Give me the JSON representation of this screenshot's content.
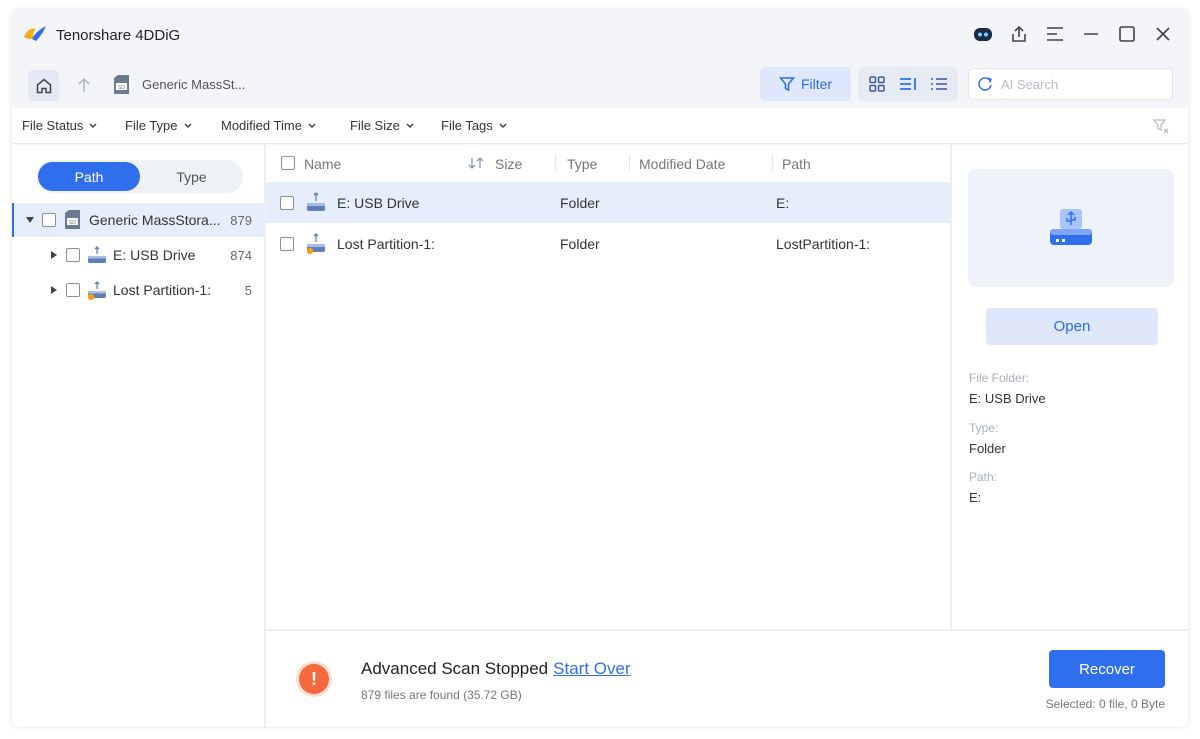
{
  "app": {
    "title": "Tenorshare 4DDiG"
  },
  "window_controls": [
    "robot-icon",
    "share-icon",
    "menu-icon",
    "minimize-icon",
    "maximize-icon",
    "close-icon"
  ],
  "nav": {
    "breadcrumb": "Generic MassSt...",
    "filter_label": "Filter",
    "search_placeholder": "AI Search"
  },
  "filters": [
    {
      "label": "File Status"
    },
    {
      "label": "File Type"
    },
    {
      "label": "Modified Time"
    },
    {
      "label": "File Size"
    },
    {
      "label": "File Tags"
    }
  ],
  "sidebar": {
    "tabs": [
      {
        "label": "Path",
        "active": true
      },
      {
        "label": "Type",
        "active": false
      }
    ],
    "tree": [
      {
        "label": "Generic MassStora...",
        "count": "879"
      },
      {
        "label": "E: USB Drive",
        "count": "874"
      },
      {
        "label": "Lost Partition-1:",
        "count": "5"
      }
    ]
  },
  "table": {
    "columns": {
      "name": "Name",
      "size": "Size",
      "type": "Type",
      "modified": "Modified Date",
      "path": "Path"
    },
    "rows": [
      {
        "name": "E: USB Drive",
        "type": "Folder",
        "path": "E:"
      },
      {
        "name": "Lost Partition-1:",
        "type": "Folder",
        "path": "LostPartition-1:"
      }
    ]
  },
  "details": {
    "open_label": "Open",
    "folder_label": "File Folder:",
    "folder_value": "E: USB Drive",
    "type_label": "Type:",
    "type_value": "Folder",
    "path_label": "Path:",
    "path_value": "E:"
  },
  "status": {
    "title": "Advanced Scan Stopped",
    "action": "Start Over",
    "subtitle": "879 files are found (35.72 GB)",
    "recover_label": "Recover",
    "selected_info": "Selected: 0 file, 0 Byte"
  },
  "colors": {
    "accent": "#2f6fed",
    "warning": "#f46a3c",
    "selection": "#e6edfb"
  }
}
